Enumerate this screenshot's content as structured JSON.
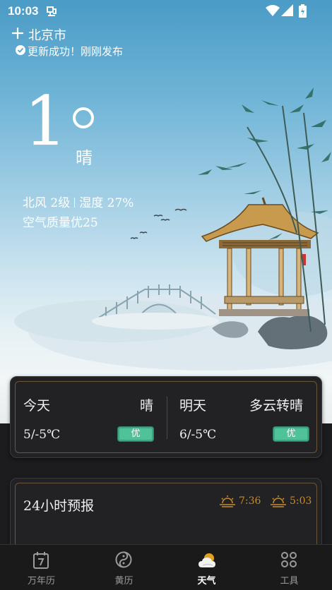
{
  "status_bar": {
    "time": "10:03",
    "icons": [
      "bug-icon",
      "wifi-icon",
      "signal-icon",
      "battery-charging-icon"
    ]
  },
  "location": {
    "add_icon": "plus-icon",
    "city": "北京市",
    "update_icon": "check-circle-icon",
    "update_text": "更新成功！刚刚发布"
  },
  "current": {
    "temperature": "1",
    "degree_icon": "degree-circle-icon",
    "condition": "晴",
    "wind": "北风 2级",
    "humidity": "湿度 27%",
    "air_quality": "空气质量优25"
  },
  "daily": {
    "today": {
      "label": "今天",
      "condition": "晴",
      "temp_range": "5/-5℃",
      "aqi": "优",
      "aqi_color": "#4fc29a"
    },
    "tomorrow": {
      "label": "明天",
      "condition": "多云转晴",
      "temp_range": "6/-5℃",
      "aqi": "优",
      "aqi_color": "#4fc29a"
    }
  },
  "forecast": {
    "title": "24小时预报",
    "sunrise": {
      "icon": "sunrise-icon",
      "time": "7:36"
    },
    "sunset": {
      "icon": "sunset-icon",
      "time": "5:03"
    }
  },
  "tabs": [
    {
      "label": "万年历",
      "icon": "calendar-icon",
      "active": false
    },
    {
      "label": "黄历",
      "icon": "yin-yang-icon",
      "active": false
    },
    {
      "label": "天气",
      "icon": "weather-icon",
      "active": true
    },
    {
      "label": "工具",
      "icon": "tools-grid-icon",
      "active": false
    }
  ],
  "colors": {
    "accent": "#c88a2a",
    "aqi_good": "#4fc29a",
    "card_border": "#6a5638"
  }
}
